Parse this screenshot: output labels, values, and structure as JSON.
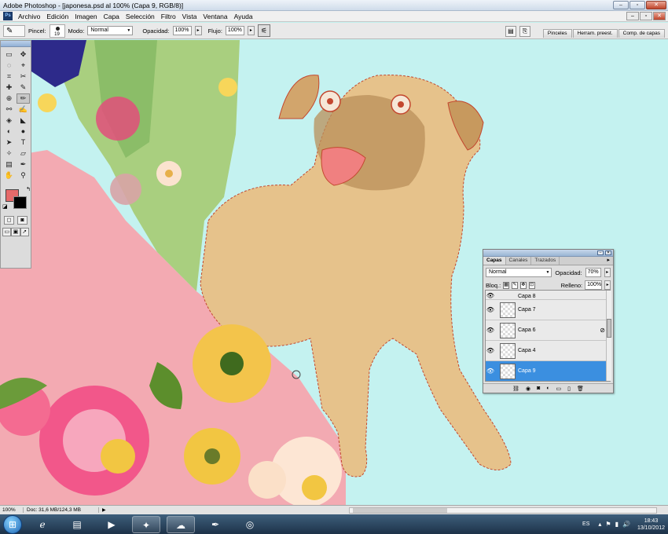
{
  "window": {
    "title": "Adobe Photoshop - [japonesa.psd al 100% (Capa 9, RGB/8)]",
    "buttons": [
      "minimize-icon",
      "maximize-icon",
      "close-icon"
    ],
    "glyphs": {
      "minimize": "–",
      "maximize": "▫",
      "close": "✕"
    }
  },
  "menubar": {
    "logo": "Ps",
    "items": [
      "Archivo",
      "Edición",
      "Imagen",
      "Capa",
      "Selección",
      "Filtro",
      "Vista",
      "Ventana",
      "Ayuda"
    ]
  },
  "options": {
    "brush_label": "Pincel:",
    "brush_size": "19",
    "mode_label": "Modo:",
    "mode_value": "Normal",
    "opacity_label": "Opacidad:",
    "opacity_value": "100%",
    "flow_label": "Flujo:",
    "flow_value": "100%",
    "palette_tabs": [
      "Pinceles",
      "Herram. preest.",
      "Comp. de capas"
    ]
  },
  "toolbox": {
    "tools": [
      "▭",
      "✥",
      "◌",
      "⌖",
      "⌗",
      "✂",
      "✚",
      "✎",
      "⊕",
      "✏",
      "⚯",
      "✍",
      "◈",
      "◣",
      "◐",
      "●",
      "➤",
      "T",
      "✧",
      "▱",
      "▤",
      "✒",
      "✋",
      "⚲"
    ],
    "active_index": 9,
    "foreground_color": "#e66a6a",
    "background_color": "#000000"
  },
  "layers_panel": {
    "tabs": [
      "Capas",
      "Canales",
      "Trazados"
    ],
    "blend_mode": "Normal",
    "opacity_label": "Opacidad:",
    "opacity_value": "70%",
    "lock_label": "Bloq.:",
    "fill_label": "Relleno:",
    "fill_value": "100%",
    "layers": [
      {
        "name": "Capa 8",
        "selected": false,
        "fx": false
      },
      {
        "name": "Capa 7",
        "selected": false,
        "fx": false
      },
      {
        "name": "Capa 6",
        "selected": false,
        "fx": true
      },
      {
        "name": "Capa 4",
        "selected": false,
        "fx": false
      },
      {
        "name": "Capa 9",
        "selected": true,
        "fx": false
      }
    ],
    "bottom_icons": [
      "link-icon",
      "fx-icon",
      "mask-icon",
      "adjustment-icon",
      "group-icon",
      "new-layer-icon",
      "trash-icon"
    ]
  },
  "statusbar": {
    "zoom": "100%",
    "doc": "Doc: 31,6 MB/124,3 MB"
  },
  "taskbar": {
    "apps": [
      "ie-icon",
      "explorer-icon",
      "media-player-icon",
      "photoshop-icon",
      "paint-icon",
      "pen-icon",
      "chrome-icon"
    ],
    "language": "ES",
    "time": "18:43",
    "date": "13/10/2012"
  },
  "colors": {
    "canvas_background": "#c4f2f0",
    "selection_highlight": "#3b8fe0",
    "pug_fill": "#e6c28b",
    "kimono_pink": "#f4a8b0"
  }
}
